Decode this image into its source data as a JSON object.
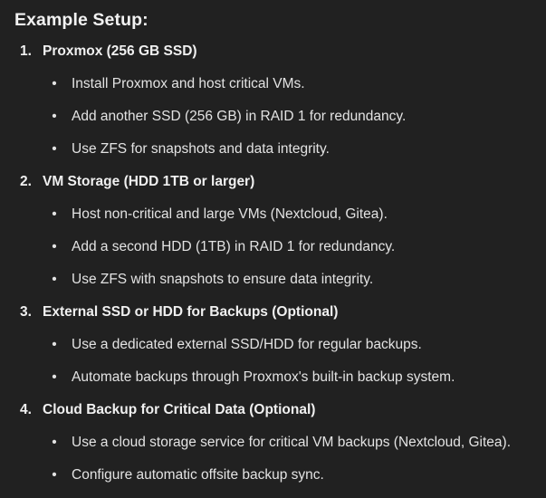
{
  "heading": "Example Setup:",
  "steps": [
    {
      "num": "1.",
      "title": "Proxmox (256 GB SSD)",
      "items": [
        "Install Proxmox and host critical VMs.",
        "Add another SSD (256 GB) in RAID 1 for redundancy.",
        "Use ZFS for snapshots and data integrity."
      ]
    },
    {
      "num": "2.",
      "title": "VM Storage (HDD 1TB or larger)",
      "items": [
        "Host non-critical and large VMs (Nextcloud, Gitea).",
        "Add a second HDD (1TB) in RAID 1 for redundancy.",
        "Use ZFS with snapshots to ensure data integrity."
      ]
    },
    {
      "num": "3.",
      "title": "External SSD or HDD for Backups (Optional)",
      "items": [
        "Use a dedicated external SSD/HDD for regular backups.",
        "Automate backups through Proxmox's built-in backup system."
      ]
    },
    {
      "num": "4.",
      "title": "Cloud Backup for Critical Data (Optional)",
      "items": [
        "Use a cloud storage service for critical VM backups (Nextcloud, Gitea).",
        "Configure automatic offsite backup sync."
      ]
    }
  ],
  "bullet_glyph": "•"
}
